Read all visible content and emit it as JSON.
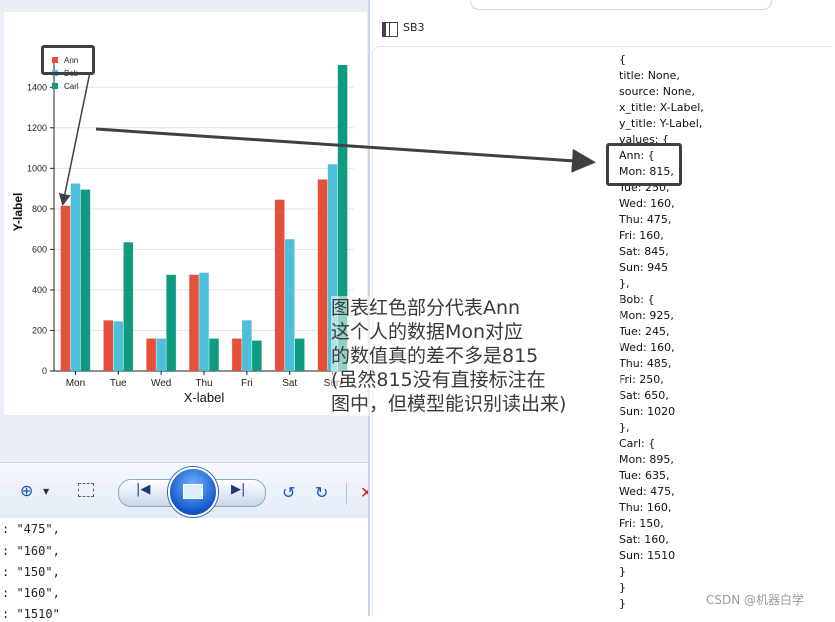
{
  "chart_data": {
    "type": "bar",
    "categories": [
      "Mon",
      "Tue",
      "Wed",
      "Thu",
      "Fri",
      "Sat",
      "Sun"
    ],
    "series": [
      {
        "name": "Ann",
        "values": [
          815,
          250,
          160,
          475,
          160,
          845,
          945
        ],
        "color": "#e5503a"
      },
      {
        "name": "Bob",
        "values": [
          925,
          245,
          160,
          485,
          250,
          650,
          1020
        ],
        "color": "#4dbfd8"
      },
      {
        "name": "Carl",
        "values": [
          895,
          635,
          475,
          160,
          150,
          160,
          1510
        ],
        "color": "#0f9b80"
      }
    ],
    "xlabel": "X-label",
    "ylabel": "Y-label",
    "ylim": [
      0,
      1500
    ],
    "yticks": [
      "0",
      "200",
      "400",
      "600",
      "800",
      "1000",
      "1200",
      "1400"
    ],
    "legend_position": "top-left",
    "grid": "horizontal"
  },
  "viewer": {
    "toolbar": {
      "zoom_icon": "zoom-in-icon",
      "fit_icon": "actual-size-icon",
      "prev_icon": "previous-icon",
      "slideshow_icon": "slideshow-icon",
      "next_icon": "next-icon",
      "rotate_left_icon": "rotate-counterclockwise-icon",
      "rotate_right_icon": "rotate-clockwise-icon",
      "delete_icon": "delete-icon"
    },
    "code_lines": [
      ": \"475\",",
      ": \"160\",",
      ": \"150\",",
      ": \"160\",",
      ": \"1510\""
    ]
  },
  "editor": {
    "file_name": "SB3",
    "lines": [
      "{",
      "title: None,",
      "source: None,",
      "x_title: X-Label,",
      "y_title: Y-Label,",
      "values: {",
      "Ann: {",
      "Mon: 815,",
      "Tue: 250,",
      "Wed: 160,",
      "Thu: 475,",
      "Fri: 160,",
      "Sat: 845,",
      "Sun: 945",
      "},",
      "Bob: {",
      "Mon: 925,",
      "Tue: 245,",
      "Wed: 160,",
      "Thu: 485,",
      "Fri: 250,",
      "Sat: 650,",
      "Sun: 1020",
      "},",
      "Carl: {",
      "Mon: 895,",
      "Tue: 635,",
      "Wed: 475,",
      "Thu: 160,",
      "Fri: 150,",
      "Sat: 160,",
      "Sun: 1510",
      "}",
      "}",
      "}"
    ]
  },
  "annotation": {
    "note_lines": [
      "图表红色部分代表Ann",
      "这个人的数据Mon对应",
      "的数值真的差不多是815",
      "(虽然815没有直接标注在",
      "图中，但模型能识别读出来)"
    ],
    "highlight_color": "#404040"
  },
  "watermark": "CSDN @机器白学"
}
